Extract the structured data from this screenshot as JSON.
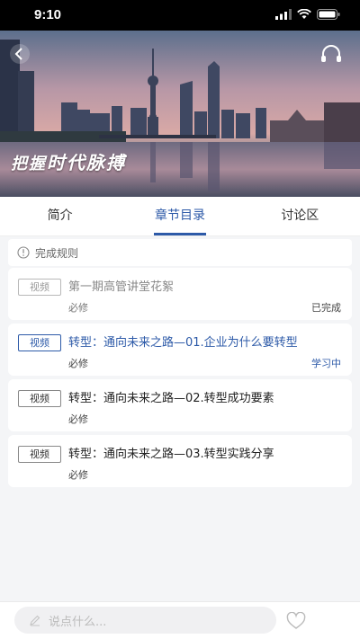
{
  "status_bar": {
    "time": "9:10"
  },
  "hero": {
    "slogan_a": "把握",
    "slogan_b": "时代脉搏"
  },
  "tabs": [
    {
      "label": "简介"
    },
    {
      "label": "章节目录",
      "active": true
    },
    {
      "label": "讨论区"
    }
  ],
  "rules": {
    "label": "完成规则"
  },
  "chapters": [
    {
      "badge": "视频",
      "title": "第一期高管讲堂花絮",
      "required": "必修",
      "status": "已完成",
      "state": "done"
    },
    {
      "badge": "视频",
      "title": "转型：通向未来之路—01.企业为什么要转型",
      "required": "必修",
      "status": "学习中",
      "state": "current"
    },
    {
      "badge": "视频",
      "title": "转型：通向未来之路—02.转型成功要素",
      "required": "必修",
      "status": "",
      "state": "normal"
    },
    {
      "badge": "视频",
      "title": "转型：通向未来之路—03.转型实践分享",
      "required": "必修",
      "status": "",
      "state": "normal"
    }
  ],
  "comment": {
    "placeholder": "说点什么..."
  },
  "colors": {
    "accent": "#2d5aa8",
    "done_text": "#888888"
  }
}
